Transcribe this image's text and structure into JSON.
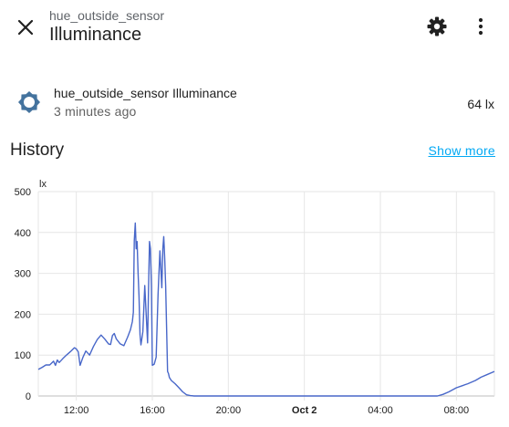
{
  "header": {
    "entity_id": "hue_outside_sensor",
    "title": "Illuminance",
    "close_icon": "close-icon",
    "settings_icon": "gear-icon",
    "menu_icon": "dots-vertical-icon"
  },
  "state": {
    "icon": "brightness-icon",
    "icon_color": "#44739e",
    "name": "hue_outside_sensor Illuminance",
    "last_changed": "3 minutes ago",
    "value": "64 lx"
  },
  "history": {
    "title": "History",
    "show_more": "Show more"
  },
  "colors": {
    "accent": "#03a9f4",
    "series": "#4867c9"
  },
  "chart_data": {
    "type": "line",
    "ylabel": "lx",
    "ylim": [
      0,
      500
    ],
    "yticks": [
      "0",
      "100",
      "200",
      "300",
      "400",
      "500"
    ],
    "xticks": [
      "12:00",
      "16:00",
      "20:00",
      "Oct 2",
      "04:00",
      "08:00"
    ],
    "x_hours": [
      10.0,
      10.2,
      10.4,
      10.6,
      10.8,
      10.9,
      11.0,
      11.1,
      11.3,
      11.5,
      11.7,
      11.9,
      12.0,
      12.1,
      12.2,
      12.35,
      12.5,
      12.7,
      12.9,
      13.1,
      13.3,
      13.5,
      13.7,
      13.8,
      13.9,
      14.0,
      14.1,
      14.3,
      14.5,
      14.7,
      14.85,
      14.95,
      15.0,
      15.05,
      15.1,
      15.15,
      15.2,
      15.25,
      15.3,
      15.35,
      15.4,
      15.5,
      15.6,
      15.7,
      15.75,
      15.8,
      15.85,
      15.9,
      15.95,
      16.0,
      16.1,
      16.2,
      16.3,
      16.4,
      16.5,
      16.55,
      16.6,
      16.65,
      16.7,
      16.75,
      16.8,
      16.85,
      16.9,
      17.0,
      17.2,
      17.4,
      17.6,
      17.8,
      18.0,
      18.2,
      18.5,
      19.0,
      20.0,
      22.0,
      24.0,
      26.0,
      28.0,
      30.0,
      31.0,
      31.3,
      31.6,
      32.0,
      32.3,
      32.6,
      33.0,
      33.3,
      33.6,
      34.0
    ],
    "values": [
      65,
      70,
      76,
      76,
      85,
      75,
      88,
      82,
      92,
      101,
      109,
      118,
      115,
      108,
      75,
      95,
      110,
      100,
      121,
      138,
      149,
      139,
      127,
      126,
      148,
      153,
      140,
      128,
      123,
      144,
      162,
      182,
      205,
      380,
      423,
      360,
      378,
      300,
      244,
      150,
      125,
      157,
      270,
      175,
      130,
      260,
      378,
      360,
      268,
      75,
      78,
      95,
      250,
      355,
      265,
      360,
      390,
      340,
      270,
      170,
      60,
      55,
      45,
      38,
      30,
      20,
      10,
      3,
      1,
      0,
      0,
      0,
      0,
      0,
      0,
      0,
      0,
      0,
      0,
      4,
      10,
      20,
      25,
      30,
      38,
      46,
      52,
      60
    ]
  }
}
